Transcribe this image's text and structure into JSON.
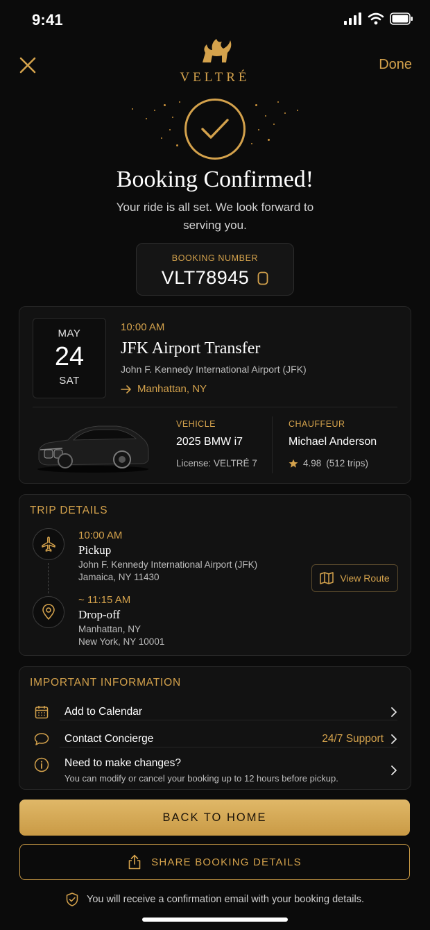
{
  "status_bar": {
    "time": "9:41"
  },
  "header": {
    "brand": "VELTRÉ",
    "done_label": "Done"
  },
  "confirmation": {
    "title": "Booking Confirmed!",
    "subtitle": "Your ride is all set. We look forward to serving you.",
    "booking_label": "BOOKING NUMBER",
    "booking_number": "VLT78945"
  },
  "ride": {
    "month": "MAY",
    "day": "24",
    "weekday": "SAT",
    "time": "10:00 AM",
    "title": "JFK Airport Transfer",
    "from": "John F. Kennedy International Airport (JFK)",
    "to": "Manhattan, NY",
    "vehicle_label": "VEHICLE",
    "vehicle": "2025 BMW i7",
    "license": "License: VELTRÉ 7",
    "chauffeur_label": "CHAUFFEUR",
    "chauffeur": "Michael Anderson",
    "rating": "4.98",
    "trips": "(512 trips)"
  },
  "trip_details": {
    "heading": "TRIP DETAILS",
    "pickup": {
      "time": "10:00 AM",
      "name": "Pickup",
      "line1": "John F. Kennedy International Airport (JFK)",
      "line2": "Jamaica, NY 11430"
    },
    "dropoff": {
      "time": "~ 11:15 AM",
      "name": "Drop-off",
      "line1": "Manhattan, NY",
      "line2": "New York, NY 10001"
    },
    "view_route_label": "View Route"
  },
  "important_info": {
    "heading": "IMPORTANT INFORMATION",
    "calendar_label": "Add to Calendar",
    "concierge_label": "Contact Concierge",
    "concierge_support": "24/7 Support",
    "changes_label": "Need to make changes?",
    "changes_sub": "You can modify or cancel your booking up to 12 hours before pickup."
  },
  "actions": {
    "home_label": "BACK TO HOME",
    "share_label": "SHARE BOOKING DETAILS"
  },
  "footer": {
    "note": "You will receive a confirmation email with your booking details."
  },
  "colors": {
    "accent": "#d4a24c",
    "background": "#0b0b0b",
    "card": "#121212"
  }
}
